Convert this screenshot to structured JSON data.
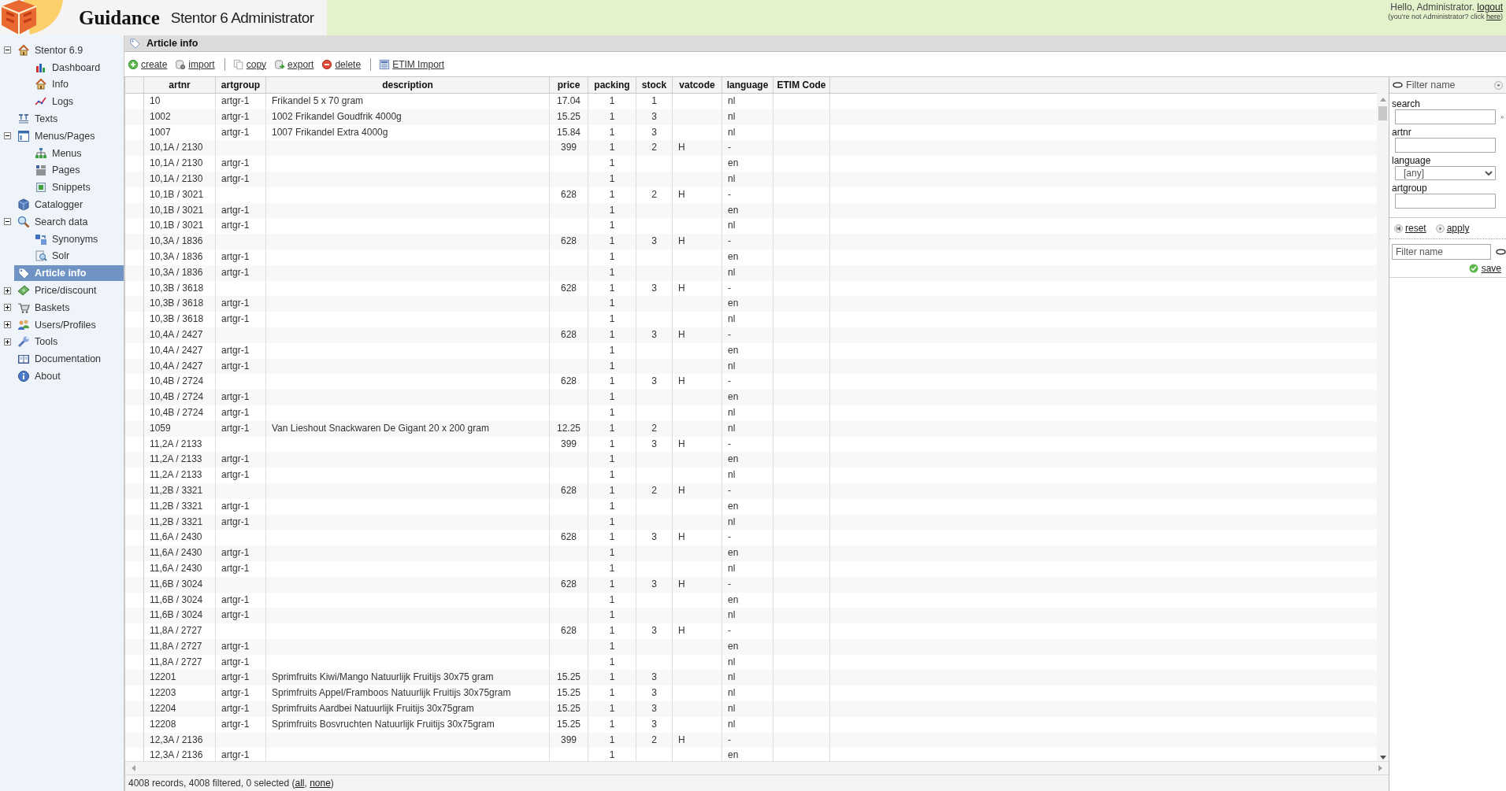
{
  "header": {
    "brand": "Guidance",
    "product": "Stentor 6 Administrator",
    "greeting": "Hello, Administrator.",
    "logout": "logout",
    "notice_prefix": "(you're not Administrator? click",
    "notice_link": "here",
    "notice_suffix": ")"
  },
  "sidebar": {
    "items": [
      {
        "label": "Stentor 6.9",
        "selected": false,
        "expanded": true,
        "children": [
          {
            "label": "Dashboard",
            "selected": false
          },
          {
            "label": "Info",
            "selected": false
          },
          {
            "label": "Logs",
            "selected": false
          }
        ]
      },
      {
        "label": "Texts",
        "selected": false
      },
      {
        "label": "Menus/Pages",
        "selected": false,
        "expanded": true,
        "children": [
          {
            "label": "Menus",
            "selected": false
          },
          {
            "label": "Pages",
            "selected": false
          },
          {
            "label": "Snippets",
            "selected": false
          }
        ]
      },
      {
        "label": "Catalogger",
        "selected": false
      },
      {
        "label": "Search data",
        "selected": false,
        "expanded": true,
        "children": [
          {
            "label": "Synonyms",
            "selected": false
          },
          {
            "label": "Solr",
            "selected": false
          }
        ]
      },
      {
        "label": "Article info",
        "selected": true
      },
      {
        "label": "Price/discount",
        "selected": false,
        "expanded": false
      },
      {
        "label": "Baskets",
        "selected": false,
        "expanded": false
      },
      {
        "label": "Users/Profiles",
        "selected": false,
        "expanded": false
      },
      {
        "label": "Tools",
        "selected": false,
        "expanded": false
      },
      {
        "label": "Documentation",
        "selected": false
      },
      {
        "label": "About",
        "selected": false
      }
    ]
  },
  "page_title": "Article info",
  "toolbar": {
    "groups": [
      [
        "create",
        "import"
      ],
      [
        "copy",
        "export",
        "delete"
      ],
      [
        "ETIM Import"
      ]
    ]
  },
  "table": {
    "columns": [
      "artnr",
      "artgroup",
      "description",
      "price",
      "packing",
      "stock",
      "vatcode",
      "language",
      "ETIM Code"
    ],
    "rows": [
      {
        "artnr": "10",
        "artgroup": "artgr-1",
        "description": "Frikandel 5 x 70 gram",
        "price": "17.04",
        "packing": "1",
        "stock": "1",
        "language": "nl"
      },
      {
        "artnr": "1002",
        "artgroup": "artgr-1",
        "description": "1002 Frikandel Goudfrik 4000g",
        "price": "15.25",
        "packing": "1",
        "stock": "3",
        "language": "nl"
      },
      {
        "artnr": "1007",
        "artgroup": "artgr-1",
        "description": "1007 Frikandel Extra 4000g",
        "price": "15.84",
        "packing": "1",
        "stock": "3",
        "language": "nl"
      },
      {
        "artnr": "10,1A / 2130",
        "price": "399",
        "packing": "1",
        "stock": "2",
        "vatcode": "H",
        "language": "-"
      },
      {
        "artnr": "10,1A / 2130",
        "artgroup": "artgr-1",
        "packing": "1",
        "language": "en"
      },
      {
        "artnr": "10,1A / 2130",
        "artgroup": "artgr-1",
        "packing": "1",
        "language": "nl"
      },
      {
        "artnr": "10,1B / 3021",
        "price": "628",
        "packing": "1",
        "stock": "2",
        "vatcode": "H",
        "language": "-"
      },
      {
        "artnr": "10,1B / 3021",
        "artgroup": "artgr-1",
        "packing": "1",
        "language": "en"
      },
      {
        "artnr": "10,1B / 3021",
        "artgroup": "artgr-1",
        "packing": "1",
        "language": "nl"
      },
      {
        "artnr": "10,3A / 1836",
        "price": "628",
        "packing": "1",
        "stock": "3",
        "vatcode": "H",
        "language": "-"
      },
      {
        "artnr": "10,3A / 1836",
        "artgroup": "artgr-1",
        "packing": "1",
        "language": "en"
      },
      {
        "artnr": "10,3A / 1836",
        "artgroup": "artgr-1",
        "packing": "1",
        "language": "nl"
      },
      {
        "artnr": "10,3B / 3618",
        "price": "628",
        "packing": "1",
        "stock": "3",
        "vatcode": "H",
        "language": "-"
      },
      {
        "artnr": "10,3B / 3618",
        "artgroup": "artgr-1",
        "packing": "1",
        "language": "en"
      },
      {
        "artnr": "10,3B / 3618",
        "artgroup": "artgr-1",
        "packing": "1",
        "language": "nl"
      },
      {
        "artnr": "10,4A / 2427",
        "price": "628",
        "packing": "1",
        "stock": "3",
        "vatcode": "H",
        "language": "-"
      },
      {
        "artnr": "10,4A / 2427",
        "artgroup": "artgr-1",
        "packing": "1",
        "language": "en"
      },
      {
        "artnr": "10,4A / 2427",
        "artgroup": "artgr-1",
        "packing": "1",
        "language": "nl"
      },
      {
        "artnr": "10,4B / 2724",
        "price": "628",
        "packing": "1",
        "stock": "3",
        "vatcode": "H",
        "language": "-"
      },
      {
        "artnr": "10,4B / 2724",
        "artgroup": "artgr-1",
        "packing": "1",
        "language": "en"
      },
      {
        "artnr": "10,4B / 2724",
        "artgroup": "artgr-1",
        "packing": "1",
        "language": "nl"
      },
      {
        "artnr": "1059",
        "artgroup": "artgr-1",
        "description": "Van Lieshout Snackwaren De Gigant 20 x 200 gram",
        "price": "12.25",
        "packing": "1",
        "stock": "2",
        "language": "nl"
      },
      {
        "artnr": "11,2A / 2133",
        "price": "399",
        "packing": "1",
        "stock": "3",
        "vatcode": "H",
        "language": "-"
      },
      {
        "artnr": "11,2A / 2133",
        "artgroup": "artgr-1",
        "packing": "1",
        "language": "en"
      },
      {
        "artnr": "11,2A / 2133",
        "artgroup": "artgr-1",
        "packing": "1",
        "language": "nl"
      },
      {
        "artnr": "11,2B / 3321",
        "price": "628",
        "packing": "1",
        "stock": "2",
        "vatcode": "H",
        "language": "-"
      },
      {
        "artnr": "11,2B / 3321",
        "artgroup": "artgr-1",
        "packing": "1",
        "language": "en"
      },
      {
        "artnr": "11,2B / 3321",
        "artgroup": "artgr-1",
        "packing": "1",
        "language": "nl"
      },
      {
        "artnr": "11,6A / 2430",
        "price": "628",
        "packing": "1",
        "stock": "3",
        "vatcode": "H",
        "language": "-"
      },
      {
        "artnr": "11,6A / 2430",
        "artgroup": "artgr-1",
        "packing": "1",
        "language": "en"
      },
      {
        "artnr": "11,6A / 2430",
        "artgroup": "artgr-1",
        "packing": "1",
        "language": "nl"
      },
      {
        "artnr": "11,6B / 3024",
        "price": "628",
        "packing": "1",
        "stock": "3",
        "vatcode": "H",
        "language": "-"
      },
      {
        "artnr": "11,6B / 3024",
        "artgroup": "artgr-1",
        "packing": "1",
        "language": "en"
      },
      {
        "artnr": "11,6B / 3024",
        "artgroup": "artgr-1",
        "packing": "1",
        "language": "nl"
      },
      {
        "artnr": "11,8A / 2727",
        "price": "628",
        "packing": "1",
        "stock": "3",
        "vatcode": "H",
        "language": "-"
      },
      {
        "artnr": "11,8A / 2727",
        "artgroup": "artgr-1",
        "packing": "1",
        "language": "en"
      },
      {
        "artnr": "11,8A / 2727",
        "artgroup": "artgr-1",
        "packing": "1",
        "language": "nl"
      },
      {
        "artnr": "12201",
        "artgroup": "artgr-1",
        "description": "Sprimfruits Kiwi/Mango Natuurlijk Fruitijs 30x75 gram",
        "price": "15.25",
        "packing": "1",
        "stock": "3",
        "language": "nl"
      },
      {
        "artnr": "12203",
        "artgroup": "artgr-1",
        "description": "Sprimfruits Appel/Framboos Natuurlijk Fruitijs 30x75gram",
        "price": "15.25",
        "packing": "1",
        "stock": "3",
        "language": "nl"
      },
      {
        "artnr": "12204",
        "artgroup": "artgr-1",
        "description": "Sprimfruits Aardbei Natuurlijk Fruitijs 30x75gram",
        "price": "15.25",
        "packing": "1",
        "stock": "3",
        "language": "nl"
      },
      {
        "artnr": "12208",
        "artgroup": "artgr-1",
        "description": "Sprimfruits Bosvruchten Natuurlijk Fruitijs 30x75gram",
        "price": "15.25",
        "packing": "1",
        "stock": "3",
        "language": "nl"
      },
      {
        "artnr": "12,3A / 2136",
        "price": "399",
        "packing": "1",
        "stock": "2",
        "vatcode": "H",
        "language": "-"
      },
      {
        "artnr": "12,3A / 2136",
        "artgroup": "artgr-1",
        "packing": "1",
        "language": "en"
      }
    ]
  },
  "status_bar": {
    "prefix": "4008 records, 4008 filtered, 0 selected (",
    "links": [
      "all",
      "none"
    ],
    "separator": ",",
    "suffix": ")"
  },
  "filter_panel": {
    "header": "Filter name",
    "fields": [
      {
        "kind": "search",
        "label": "search"
      },
      {
        "kind": "text",
        "label": "artnr"
      },
      {
        "kind": "select",
        "label": "language",
        "value": "[any]"
      },
      {
        "kind": "text",
        "label": "artgroup"
      }
    ],
    "actions": [
      "reset",
      "apply"
    ],
    "name_field": {
      "placeholder": "Filter name"
    },
    "save": "save"
  }
}
